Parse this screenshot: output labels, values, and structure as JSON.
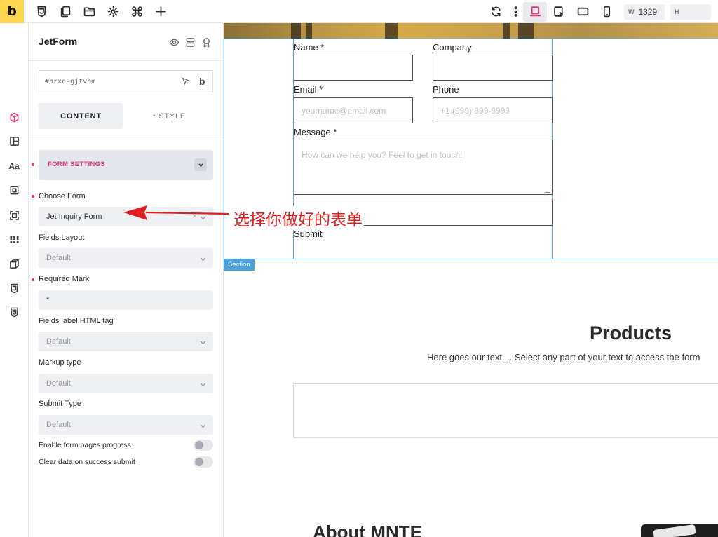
{
  "topbar": {
    "logo": "b",
    "width_label": "W",
    "width_value": "1329",
    "height_label": "H",
    "height_value": "",
    "accent": "#e5327a",
    "logo_bg": "#ffd64f",
    "left_icons": [
      "css3-icon",
      "copy-pages-icon",
      "folder-icon",
      "gear-icon",
      "command-icon",
      "plus-icon"
    ],
    "right_icons": [
      "refresh-icon",
      "more-vertical-icon",
      "desktop-breakpoint-icon",
      "tablet-landscape-icon",
      "tablet-portrait-icon",
      "mobile-icon"
    ]
  },
  "sidebar_icons": [
    "cube-icon",
    "layout-icon",
    "typography-icon",
    "element-icon",
    "frame-icon",
    "grid-dots-icon",
    "box-3d-icon",
    "css3-icon",
    "html5-icon"
  ],
  "panel": {
    "title": "JetForm",
    "element_id": "#brxe-gjtvhm",
    "id_icon": "b",
    "tabs": {
      "content": "CONTENT",
      "style": "STYLE"
    },
    "group_label": "FORM SETTINGS",
    "fields": [
      {
        "label": "Choose Form",
        "value": "Jet Inquiry Form",
        "clearable": true
      },
      {
        "label": "Fields Layout",
        "value": "Default"
      },
      {
        "label": "Required Mark",
        "value": "*"
      },
      {
        "label": "Fields label HTML tag",
        "value": "Default"
      },
      {
        "label": "Markup type",
        "value": "Default"
      },
      {
        "label": "Submit Type",
        "value": "Default"
      }
    ],
    "toggles": [
      {
        "label": "Enable form pages progress",
        "on": false
      },
      {
        "label": "Clear data on success submit",
        "on": false
      }
    ]
  },
  "canvas": {
    "form": {
      "name_label": "Name *",
      "company_label": "Company",
      "email_label": "Email *",
      "email_placeholder": "yourname@email.com",
      "phone_label": "Phone",
      "phone_placeholder": "+1 (999) 999-9999",
      "message_label": "Message *",
      "message_placeholder": "How can we help you? Feel to get in touch!",
      "submit_label": "Submit"
    },
    "section_tag": "Section",
    "products_title": "Products",
    "products_text": "Here goes our text ... Select any part of your text to access the form",
    "about_title": "About MNTE"
  },
  "annotation": {
    "text": "选择你做好的表单",
    "color": "#e02020"
  }
}
